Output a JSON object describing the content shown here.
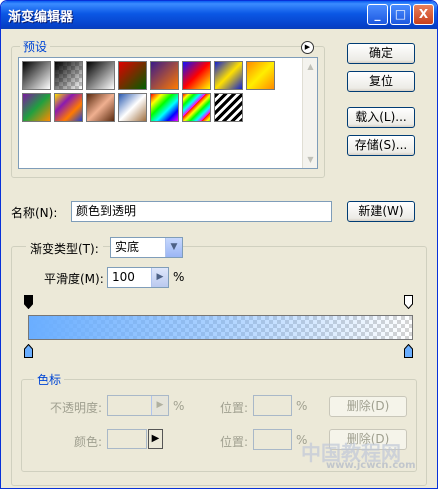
{
  "window": {
    "title": "渐变编辑器",
    "minimize": "_",
    "maximize": "□",
    "close": "X"
  },
  "presets": {
    "legend": "预设",
    "swatches": [
      {
        "name": "foreground-to-background",
        "css": "linear-gradient(135deg,#000,#fff)"
      },
      {
        "name": "foreground-to-transparent",
        "css": "linear-gradient(135deg,#000,rgba(0,0,0,0))"
      },
      {
        "name": "black-white",
        "css": "linear-gradient(135deg,#000,#fff)"
      },
      {
        "name": "red-green",
        "css": "linear-gradient(135deg,#e00000,#006000)"
      },
      {
        "name": "violet-orange",
        "css": "linear-gradient(135deg,#3a1a8a,#ff7a00)"
      },
      {
        "name": "blue-red-yellow",
        "css": "linear-gradient(135deg,#1010ff,#ff0000,#ffff00)"
      },
      {
        "name": "blue-yellow-blue",
        "css": "linear-gradient(135deg,#1020d0,#ffe000,#1020d0)"
      },
      {
        "name": "orange-yellow-orange",
        "css": "linear-gradient(135deg,#ff8a00,#ffee00,#ff8a00)"
      },
      {
        "name": "violet-green-orange",
        "css": "linear-gradient(135deg,#7a1aa0,#20a040,#ff8a00)"
      },
      {
        "name": "yellow-violet-orange-blue",
        "css": "linear-gradient(135deg,#ffe000,#8a1ab0,#ff7a00,#2040d0)"
      },
      {
        "name": "copper",
        "css": "linear-gradient(135deg,#5a2a10,#f0b090,#5a2a10)"
      },
      {
        "name": "chrome",
        "css": "linear-gradient(135deg,#2a5ab0,#ffffff,#a07040)"
      },
      {
        "name": "spectrum",
        "css": "linear-gradient(135deg,#ff0000,#ffff00,#00ff00,#00ffff,#0000ff,#ff00ff)"
      },
      {
        "name": "transparent-rainbow",
        "css": "repeating-linear-gradient(135deg,#ff0000 0,#ffff00 4px,#00ff00 8px,#00ffff 12px,#ff00ff 16px)"
      },
      {
        "name": "transparent-stripes",
        "css": "repeating-linear-gradient(135deg,#000 0,#000 3px,#fff 3px,#fff 6px)"
      }
    ]
  },
  "buttons": {
    "ok": "确定",
    "reset": "复位",
    "load": "载入(L)...",
    "save": "存储(S)...",
    "new": "新建(W)",
    "delete_opacity": "删除(D)",
    "delete_color": "删除(D)"
  },
  "name": {
    "label": "名称(N):",
    "value": "颜色到透明"
  },
  "gradient": {
    "type_label": "渐变类型(T):",
    "type_value": "实底",
    "smoothness_label": "平滑度(M):",
    "smoothness_value": "100",
    "smoothness_unit": "%",
    "color_start": "#6aaeff",
    "color_end": "#6aaeff"
  },
  "color_stops": {
    "legend": "色标",
    "opacity_label": "不透明度:",
    "opacity_unit": "%",
    "location_label_1": "位置:",
    "location_unit_1": "%",
    "color_label": "颜色:",
    "location_label_2": "位置:",
    "location_unit_2": "%"
  },
  "watermark": {
    "text": "中国教程网",
    "url": "www.jcwcn.com"
  }
}
